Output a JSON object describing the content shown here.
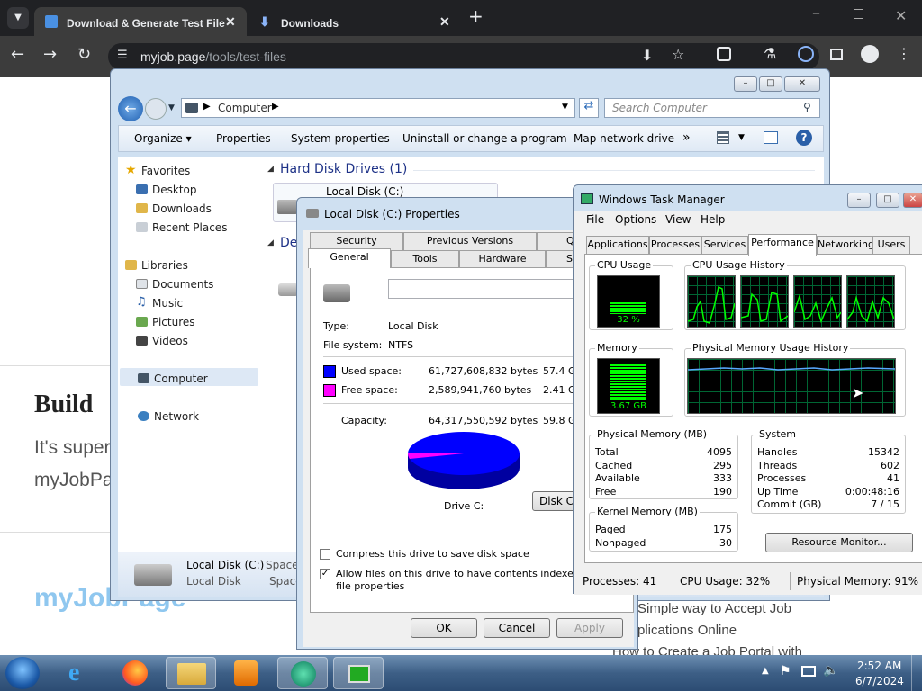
{
  "browser": {
    "tabs": [
      {
        "title": "Download & Generate Test File"
      },
      {
        "title": "Downloads"
      }
    ],
    "url_domain": "myjob.page",
    "url_path": "/tools/test-files"
  },
  "webpage": {
    "heading_partial": "Build",
    "text_line1": "It's super",
    "text_line2": "myJobPa",
    "logo": "myJobPage",
    "article1_line1": "Simple way to Accept Job",
    "article1_line2": "plications Online",
    "article2_partial": "How to Create a Job Portal with"
  },
  "explorer": {
    "address": "Computer",
    "search_placeholder": "Search Computer",
    "toolbar": {
      "organize": "Organize",
      "properties": "Properties",
      "system_properties": "System properties",
      "uninstall": "Uninstall or change a program",
      "map_drive": "Map network drive",
      "more": "»"
    },
    "nav": {
      "favorites": "Favorites",
      "desktop": "Desktop",
      "downloads": "Downloads",
      "recent_places": "Recent Places",
      "libraries": "Libraries",
      "documents": "Documents",
      "music": "Music",
      "pictures": "Pictures",
      "videos": "Videos",
      "computer": "Computer",
      "network": "Network"
    },
    "section_hdd": "Hard Disk Drives (1)",
    "section_devices_partial": "De",
    "drive_name": "Local Disk (C:)",
    "details": {
      "name": "Local Disk (C:)",
      "type": "Local Disk",
      "space1": "Space",
      "space2": "Space"
    }
  },
  "properties": {
    "title": "Local Disk (C:) Properties",
    "tabs_back": [
      "Security",
      "Previous Versions",
      "Q"
    ],
    "tabs_front": [
      "General",
      "Tools",
      "Hardware",
      "S"
    ],
    "type_label": "Type:",
    "type_value": "Local Disk",
    "fs_label": "File system:",
    "fs_value": "NTFS",
    "used_label": "Used space:",
    "used_bytes": "61,727,608,832 bytes",
    "used_gb": "57.4 G",
    "free_label": "Free space:",
    "free_bytes": "2,589,941,760 bytes",
    "free_gb": "2.41 G",
    "capacity_label": "Capacity:",
    "capacity_bytes": "64,317,550,592 bytes",
    "capacity_gb": "59.8 G",
    "drive_label": "Drive C:",
    "cleanup_btn": "Disk C",
    "compress_label": "Compress this drive to save disk space",
    "index_label1": "Allow files on this drive to have contents indexed in addi",
    "index_label2": "file properties",
    "compress_checked": false,
    "index_checked": true,
    "ok": "OK",
    "cancel": "Cancel",
    "apply": "Apply",
    "used_color": "#0000ff",
    "free_color": "#ff00ff",
    "used_fraction": 0.96
  },
  "taskmgr": {
    "title": "Windows Task Manager",
    "menu": [
      "File",
      "Options",
      "View",
      "Help"
    ],
    "tabs": [
      "Applications",
      "Processes",
      "Services",
      "Performance",
      "Networking",
      "Users"
    ],
    "active_tab": "Performance",
    "cpu_usage_label": "CPU Usage",
    "cpu_value": "32 %",
    "cpu_fraction": 0.32,
    "cpu_history_label": "CPU Usage History",
    "memory_label": "Memory",
    "memory_value": "3.67 GB",
    "memory_fraction": 0.91,
    "mem_history_label": "Physical Memory Usage History",
    "phys_mem": {
      "label": "Physical Memory (MB)",
      "rows": [
        {
          "k": "Total",
          "v": "4095"
        },
        {
          "k": "Cached",
          "v": "295"
        },
        {
          "k": "Available",
          "v": "333"
        },
        {
          "k": "Free",
          "v": "190"
        }
      ]
    },
    "system": {
      "label": "System",
      "rows": [
        {
          "k": "Handles",
          "v": "15342"
        },
        {
          "k": "Threads",
          "v": "602"
        },
        {
          "k": "Processes",
          "v": "41"
        },
        {
          "k": "Up Time",
          "v": "0:00:48:16"
        },
        {
          "k": "Commit (GB)",
          "v": "7 / 15"
        }
      ]
    },
    "kernel_mem": {
      "label": "Kernel Memory (MB)",
      "rows": [
        {
          "k": "Paged",
          "v": "175"
        },
        {
          "k": "Nonpaged",
          "v": "30"
        }
      ]
    },
    "resource_monitor": "Resource Monitor...",
    "status": {
      "processes": "Processes: 41",
      "cpu": "CPU Usage: 32%",
      "memory": "Physical Memory: 91%"
    }
  },
  "taskbar": {
    "time": "2:52 AM",
    "date": "6/7/2024"
  }
}
